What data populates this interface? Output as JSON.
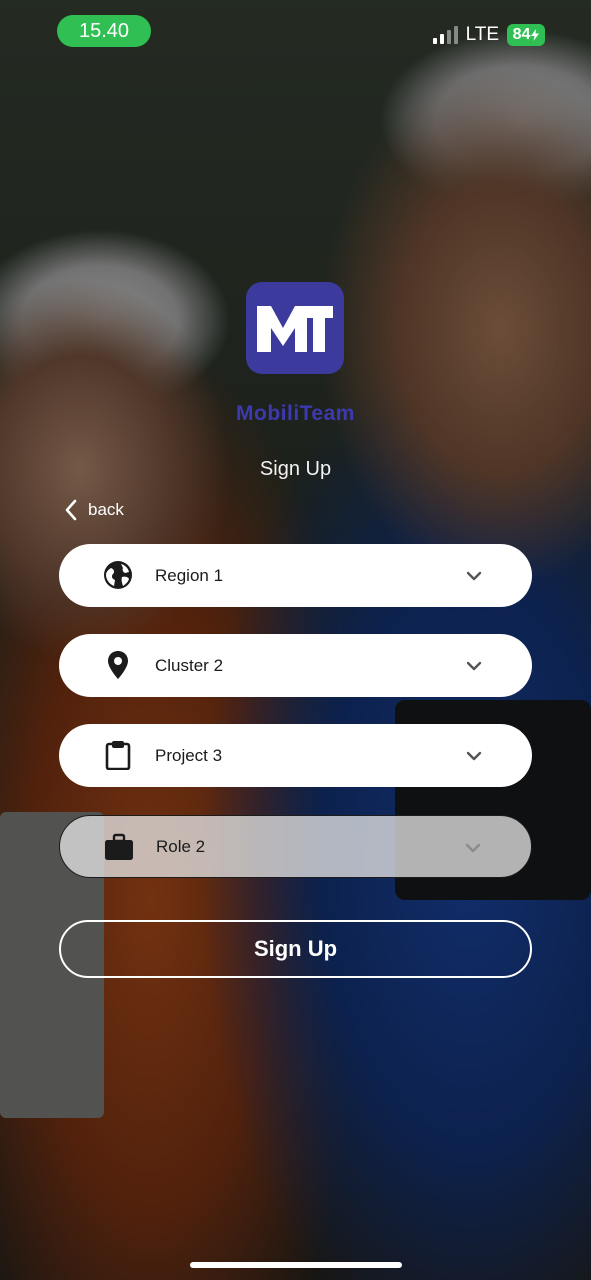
{
  "status_bar": {
    "time": "15.40",
    "network": "LTE",
    "battery": "84"
  },
  "brand": {
    "logo_text": "MT",
    "name": "MobiliTeam"
  },
  "page": {
    "title": "Sign Up",
    "back_label": "back"
  },
  "fields": [
    {
      "label": "Region 1",
      "icon": "globe-icon"
    },
    {
      "label": "Cluster 2",
      "icon": "location-pin-icon"
    },
    {
      "label": "Project 3",
      "icon": "clipboard-icon"
    },
    {
      "label": "Role 2",
      "icon": "briefcase-icon"
    }
  ],
  "actions": {
    "signup_label": "Sign Up"
  },
  "colors": {
    "time_pill": "#2fbf52",
    "logo_bg": "#3c3a9c",
    "brand_text": "#3d3ab0"
  }
}
